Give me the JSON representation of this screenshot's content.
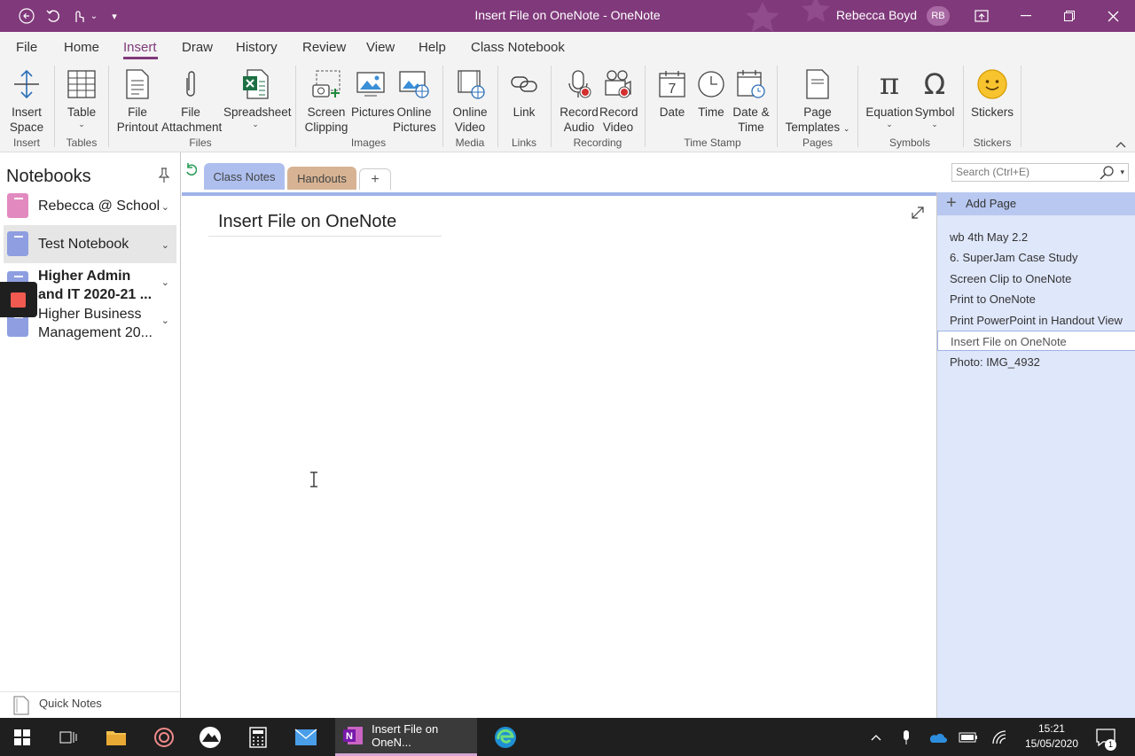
{
  "window": {
    "title": "Insert File on OneNote  -  OneNote",
    "user_name": "Rebecca Boyd",
    "user_initials": "RB"
  },
  "ribbon_tabs": [
    "File",
    "Home",
    "Insert",
    "Draw",
    "History",
    "Review",
    "View",
    "Help",
    "Class Notebook"
  ],
  "ribbon": {
    "insert_space": [
      "Insert",
      "Space"
    ],
    "table": "Table",
    "file_printout": [
      "File",
      "Printout"
    ],
    "file_attachment": [
      "File",
      "Attachment"
    ],
    "spreadsheet": "Spreadsheet",
    "screen_clipping": [
      "Screen",
      "Clipping"
    ],
    "pictures": "Pictures",
    "online_pictures": [
      "Online",
      "Pictures"
    ],
    "online_video": [
      "Online",
      "Video"
    ],
    "link": "Link",
    "record_audio": [
      "Record",
      "Audio"
    ],
    "record_video": [
      "Record",
      "Video"
    ],
    "date": "Date",
    "time": "Time",
    "date_time": [
      "Date &",
      "Time"
    ],
    "page_templates": [
      "Page",
      "Templates"
    ],
    "equation": "Equation",
    "symbol": "Symbol",
    "stickers": "Stickers",
    "date_icon_number": "7",
    "equation_glyph": "π",
    "symbol_glyph": "Ω",
    "groups": {
      "insert": "Insert",
      "tables": "Tables",
      "files": "Files",
      "images": "Images",
      "media": "Media",
      "links": "Links",
      "recording": "Recording",
      "time_stamp": "Time Stamp",
      "pages": "Pages",
      "symbols": "Symbols",
      "stickers": "Stickers"
    }
  },
  "notebooks": {
    "title": "Notebooks",
    "items": [
      {
        "label": "Rebecca @ School",
        "color": "#e28ac0"
      },
      {
        "label": "Test Notebook",
        "color": "#8e9ee0"
      },
      {
        "label": "Higher Admin and IT 2020-21 ...",
        "color": "#8e9ee0"
      },
      {
        "label": "Higher Business Management 20...",
        "color": "#8e9ee0"
      }
    ],
    "quick_notes": "Quick Notes"
  },
  "sections": {
    "tabs": [
      "Class Notes",
      "Handouts"
    ],
    "add": "+"
  },
  "search": {
    "placeholder": "Search (Ctrl+E)"
  },
  "page": {
    "title": "Insert File on OneNote"
  },
  "pages_pane": {
    "add_page": "Add Page",
    "items": [
      "wb 4th May 2.2",
      "6. SuperJam Case Study",
      "Screen Clip to OneNote",
      "Print to OneNote",
      "Print PowerPoint in Handout View",
      "Insert File on OneNote",
      "Photo: IMG_4932"
    ],
    "selected_index": 5
  },
  "taskbar": {
    "active_app": "Insert File on OneN...",
    "onenote_letter": "N",
    "time": "15:21",
    "date": "15/05/2020",
    "notifications": "1"
  },
  "colors": {
    "accent": "#80397b",
    "section_class_notes": "#aebfee",
    "section_handouts": "#d7b393"
  }
}
